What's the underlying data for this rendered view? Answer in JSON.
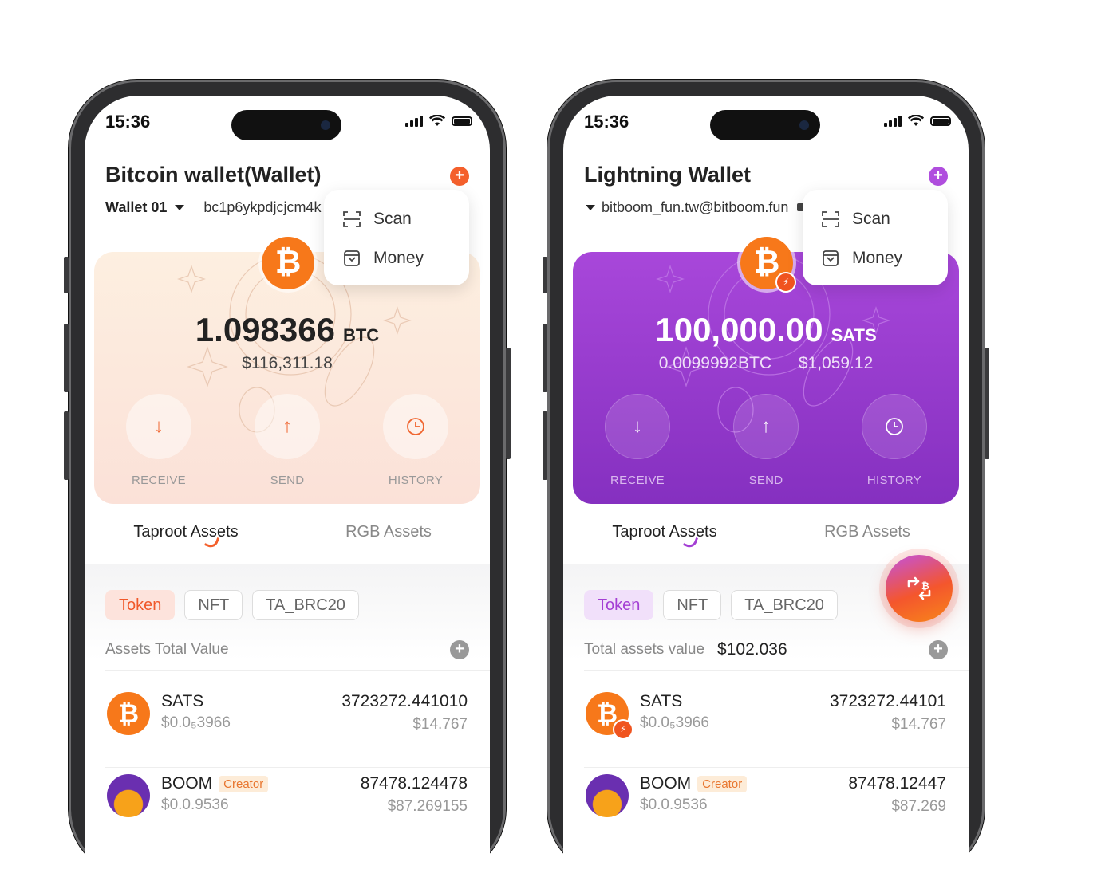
{
  "status": {
    "time": "15:36"
  },
  "phones": [
    {
      "title": "Bitcoin wallet(Wallet)",
      "wallet_name": "Wallet 01",
      "address": "bc1p6ykpdjcjcm4k",
      "menu": {
        "scan": "Scan",
        "money": "Money"
      },
      "balance": {
        "amount": "1.098366",
        "unit": "BTC",
        "fiat": "$116,311.18"
      },
      "actions": {
        "receive": "RECEIVE",
        "send": "SEND",
        "history": "HISTORY"
      },
      "tabs": {
        "taproot": "Taproot Assets",
        "rgb": "RGB Assets"
      },
      "chips": {
        "token": "Token",
        "nft": "NFT",
        "brc20": "TA_BRC20"
      },
      "totals": {
        "label": "Assets Total Value",
        "value": ""
      },
      "assets": [
        {
          "name": "SATS",
          "price": "$0.0₅3966",
          "qty": "3723272.441010",
          "usd": "$14.767"
        },
        {
          "name": "BOOM",
          "badge": "Creator",
          "price": "$0.0.9536",
          "qty": "87478.124478",
          "usd": "$87.269155"
        }
      ],
      "colors": {
        "accent": "#f4602c",
        "card_from": "#fdeedd",
        "card_to": "#fde0d8"
      }
    },
    {
      "title": "Lightning Wallet",
      "wallet_name": "",
      "address": "bitboom_fun.tw@bitboom.fun",
      "menu": {
        "scan": "Scan",
        "money": "Money"
      },
      "balance": {
        "amount": "100,000.00",
        "unit": "SATS",
        "btc": "0.0099992BTC",
        "fiat": "$1,059.12"
      },
      "actions": {
        "receive": "RECEIVE",
        "send": "SEND",
        "history": "HISTORY"
      },
      "tabs": {
        "taproot": "Taproot Assets",
        "rgb": "RGB Assets"
      },
      "chips": {
        "token": "Token",
        "nft": "NFT",
        "brc20": "TA_BRC20"
      },
      "totals": {
        "label": "Total assets value",
        "value": "$102.036"
      },
      "assets": [
        {
          "name": "SATS",
          "price": "$0.0₅3966",
          "qty": "3723272.44101",
          "usd": "$14.767"
        },
        {
          "name": "BOOM",
          "badge": "Creator",
          "price": "$0.0.9536",
          "qty": "87478.12447",
          "usd": "$87.269"
        }
      ],
      "colors": {
        "accent": "#a43fd4",
        "card_from": "#a544d8",
        "card_to": "#8a2fc2"
      }
    }
  ]
}
